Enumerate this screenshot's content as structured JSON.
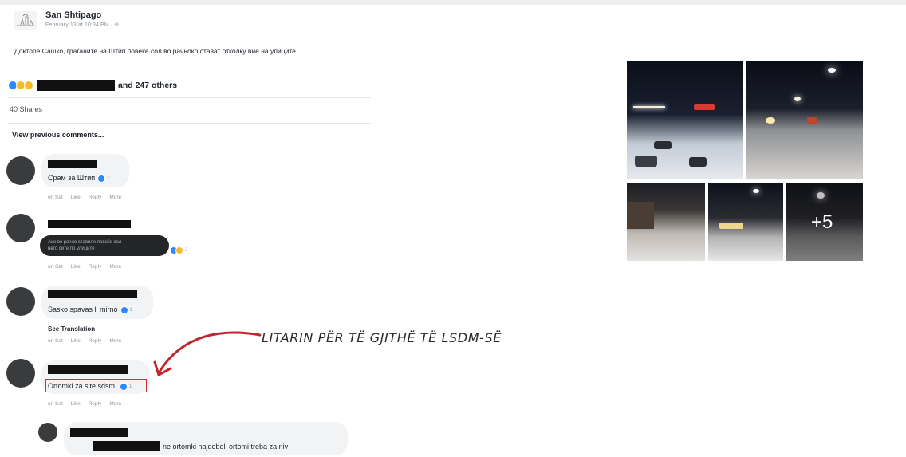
{
  "post": {
    "page_name": "San Shtipago",
    "timestamp": "February 13 at 10:34 PM · ⊘",
    "text": "Докторе Сашко, граѓаните на Штип повеќе сол во рачнoко стават отколку вие на улиците"
  },
  "reactions": {
    "icons": [
      "like-icon",
      "haha-icon",
      "wow-icon"
    ],
    "others_text": "and 247 others",
    "shares": "40 Shares"
  },
  "view_previous": "View previous comments...",
  "comments": [
    {
      "text": "Срам за Штип",
      "react_count": "1",
      "actions": [
        "on Sat",
        "Like",
        "Reply",
        "More"
      ]
    },
    {
      "text_line1": "Ако во рачно ставиле повеќе сол",
      "text_line2": "него сите по улиците",
      "react_count": "2",
      "actions": [
        "on Sat",
        "Like",
        "Reply",
        "More"
      ]
    },
    {
      "text": "Sasko spavas li mirno",
      "react_count": "1",
      "see_translation": "See Translation",
      "actions": [
        "on Sat",
        "Like",
        "Reply",
        "More"
      ]
    },
    {
      "text": "Ortomki za site sdsm",
      "react_count": "1",
      "actions": [
        "on Sat",
        "Like",
        "Reply",
        "More"
      ]
    }
  ],
  "reply": {
    "text": "ne ortomki najdebeli ortomi treba za niv"
  },
  "annotation": {
    "text": "LITARIN PËR TË GJITHË TË LSDM-SË",
    "color": "#c0262d"
  },
  "photos": {
    "more_count": "+5"
  },
  "colors": {
    "like_blue": "#2d88ff",
    "emoji_yellow": "#f7b928",
    "highlight_red": "#d0303a"
  }
}
